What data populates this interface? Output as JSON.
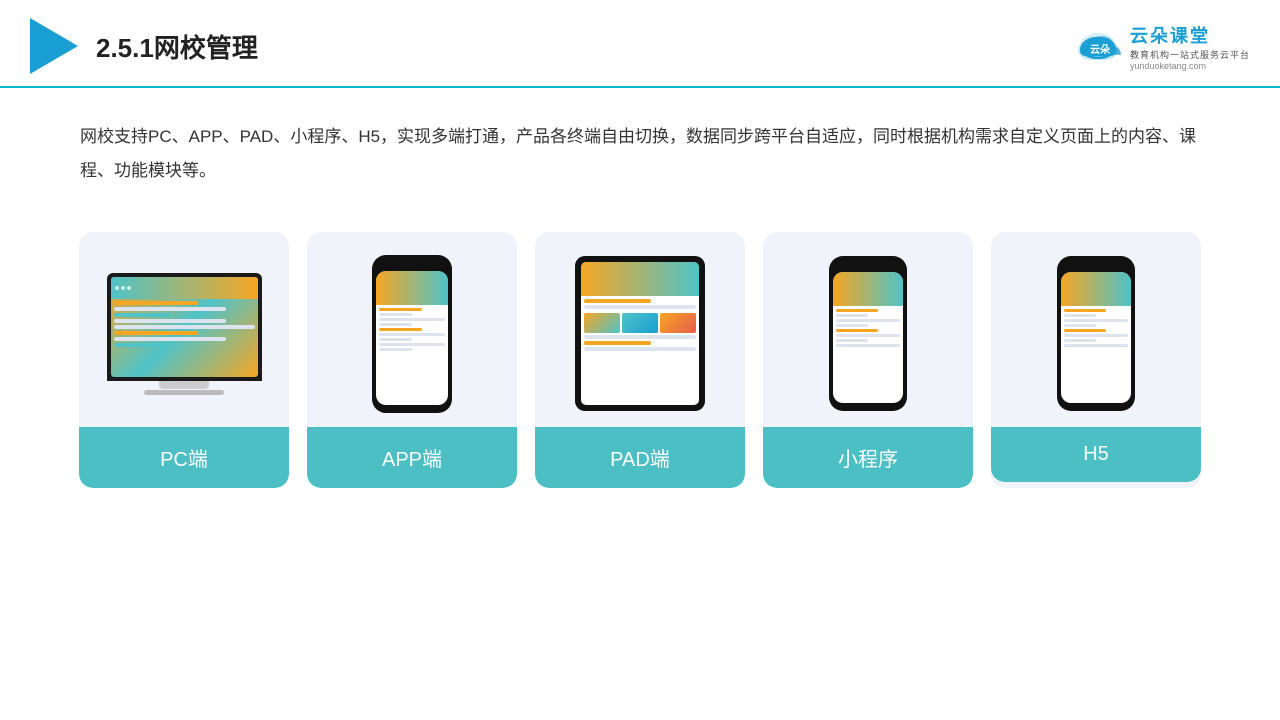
{
  "header": {
    "title": "2.5.1网校管理",
    "brand": {
      "name": "云朵课堂",
      "url": "yunduoketang.com",
      "subtitle": "教育机构一站式服务云平台"
    }
  },
  "description": "网校支持PC、APP、PAD、小程序、H5，实现多端打通，产品各终端自由切换，数据同步跨平台自适应，同时根据机构需求自定义页面上的内容、课程、功能模块等。",
  "cards": [
    {
      "id": "pc",
      "label": "PC端",
      "type": "pc"
    },
    {
      "id": "app",
      "label": "APP端",
      "type": "phone"
    },
    {
      "id": "pad",
      "label": "PAD端",
      "type": "tablet"
    },
    {
      "id": "mini",
      "label": "小程序",
      "type": "phone"
    },
    {
      "id": "h5",
      "label": "H5",
      "type": "phone"
    }
  ],
  "colors": {
    "accent": "#4bbfc3",
    "teal": "#4fc3c8",
    "orange": "#f6a623",
    "dark": "#1a1a1a"
  }
}
